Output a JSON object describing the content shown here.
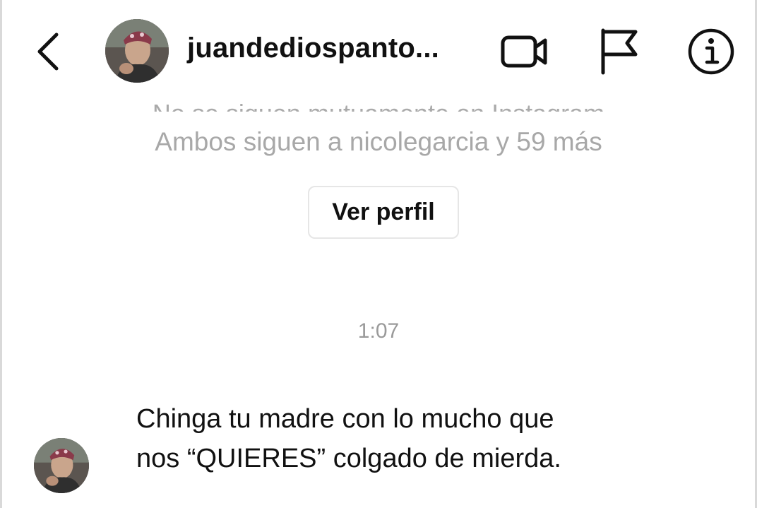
{
  "header": {
    "username": "juandediospanto...",
    "back_icon": "chevron-left-icon",
    "video_icon": "video-camera-icon",
    "flag_icon": "flag-icon",
    "info_icon": "info-icon"
  },
  "profile_info": {
    "clipped_line": "No se siguen mutuamente en Instagram",
    "mutual_followers": "Ambos siguen a nicolegarcia y 59 más",
    "view_profile_label": "Ver perfil"
  },
  "thread": {
    "timestamp": "1:07",
    "messages": [
      {
        "lines": [
          "Chinga tu madre con lo mucho que",
          "nos “QUIERES” colgado de mierda."
        ]
      }
    ]
  },
  "colors": {
    "text_primary": "#111111",
    "text_secondary": "#a8a8a8",
    "button_border": "#e6e6e6",
    "background": "#ffffff"
  }
}
